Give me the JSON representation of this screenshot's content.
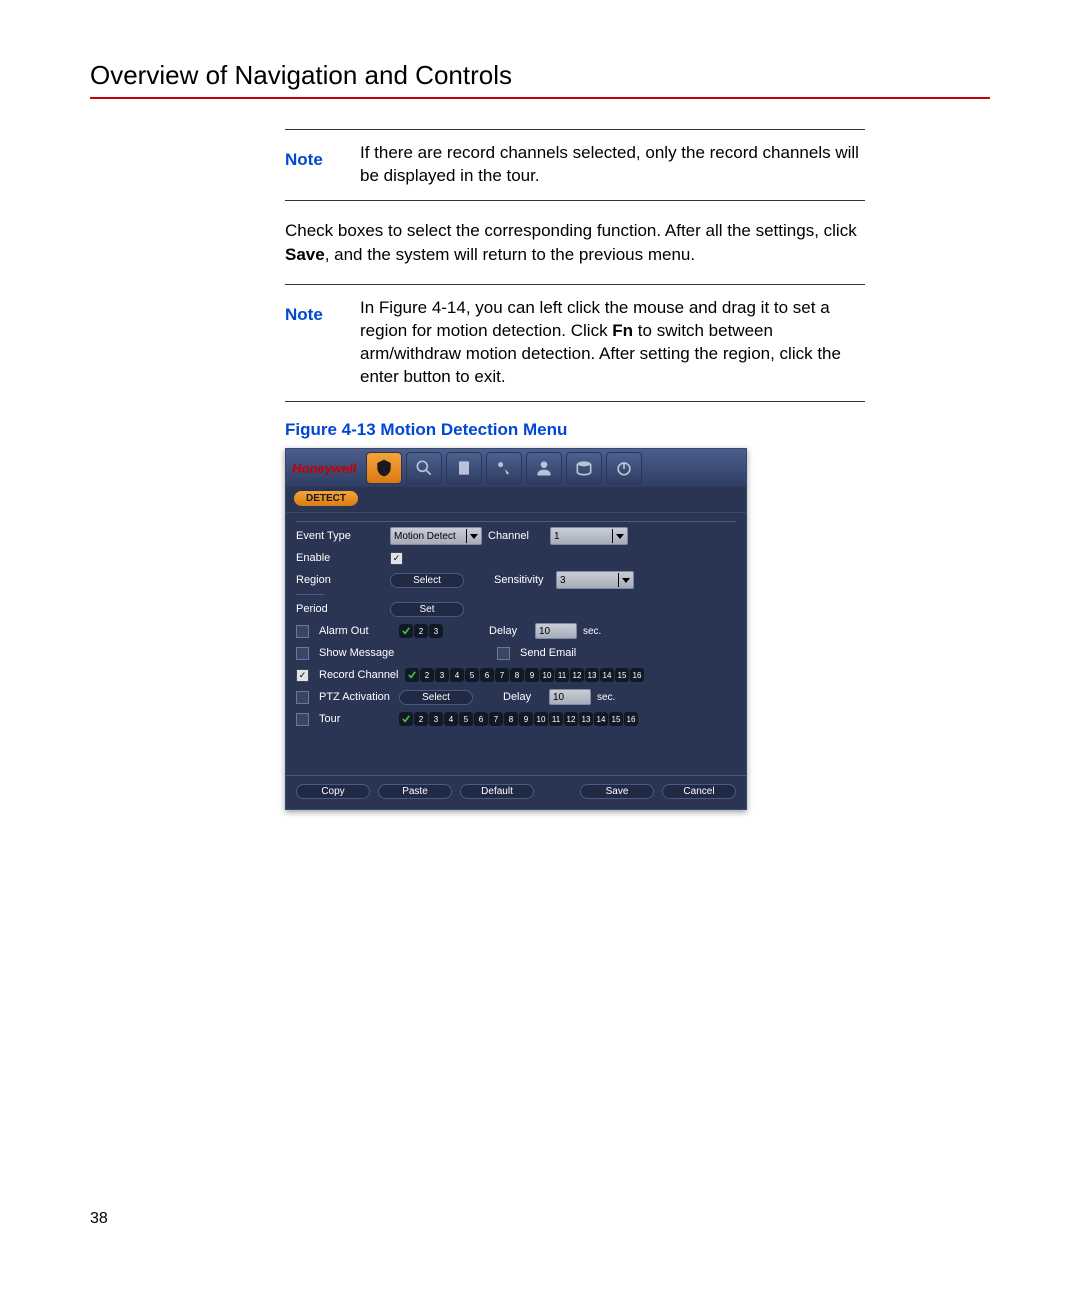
{
  "header": {
    "title": "Overview of Navigation and Controls"
  },
  "note1": {
    "label": "Note",
    "text": "If there are record channels selected, only the record channels will be displayed in the tour."
  },
  "para1": {
    "text_a": "Check boxes to select the corresponding function. After all the settings, click ",
    "bold": "Save",
    "text_b": ", and the system will return to the previous menu."
  },
  "note2": {
    "label": "Note",
    "text_a": "In ",
    "figref": "Figure 4-14",
    "text_b": ", you can left click the mouse and drag it to set a region for motion detection. Click ",
    "bold": "Fn",
    "text_c": " to switch between arm/withdraw motion detection. After setting the region, click the enter button to exit."
  },
  "figcaption": "Figure 4-13 Motion Detection Menu",
  "dvr": {
    "brand": "Honeywell",
    "badge": "DETECT",
    "labels": {
      "event_type": "Event Type",
      "channel": "Channel",
      "enable": "Enable",
      "region": "Region",
      "sensitivity": "Sensitivity",
      "period": "Period",
      "alarm_out": "Alarm Out",
      "delay": "Delay",
      "show_message": "Show Message",
      "send_email": "Send Email",
      "record_channel": "Record Channel",
      "ptz_activation": "PTZ Activation",
      "tour": "Tour",
      "sec": "sec."
    },
    "values": {
      "event_type": "Motion Detect",
      "channel": "1",
      "sensitivity": "3",
      "alarm_delay": "10",
      "ptz_delay": "10",
      "alarm_out": [
        "1",
        "2",
        "3"
      ]
    },
    "buttons": {
      "select": "Select",
      "set": "Set",
      "copy": "Copy",
      "paste": "Paste",
      "default": "Default",
      "save": "Save",
      "cancel": "Cancel"
    },
    "channels": [
      "1",
      "2",
      "3",
      "4",
      "5",
      "6",
      "7",
      "8",
      "9",
      "10",
      "11",
      "12",
      "13",
      "14",
      "15",
      "16"
    ]
  },
  "page_number": "38"
}
